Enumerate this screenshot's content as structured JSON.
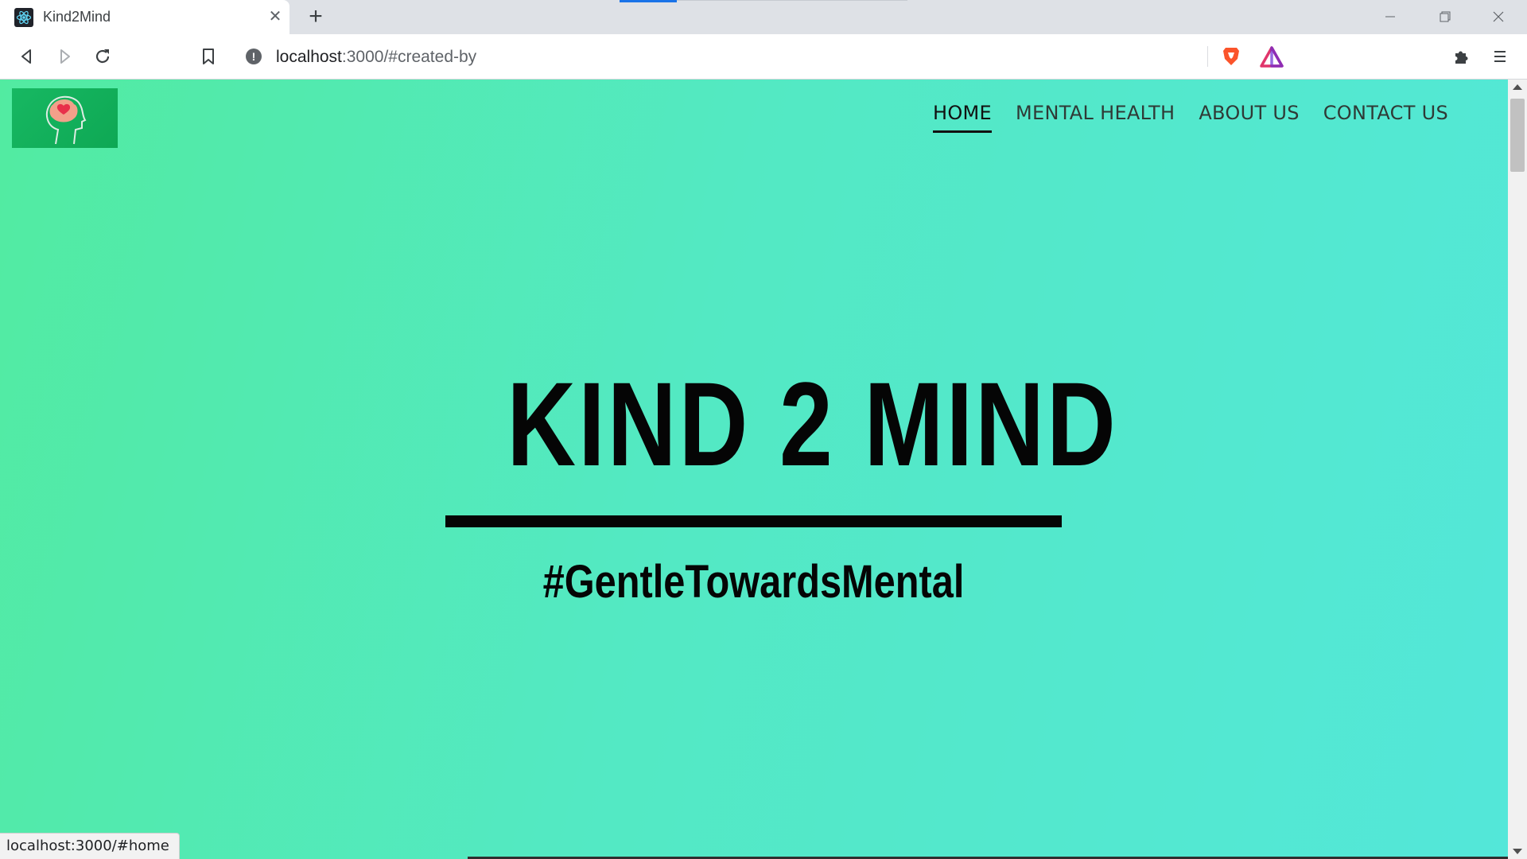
{
  "browser": {
    "tab": {
      "title": "Kind2Mind",
      "favicon": "react-icon"
    },
    "address": {
      "host": "localhost",
      "path": ":3000/#created-by"
    },
    "status_url": "localhost:3000/#home"
  },
  "site": {
    "nav": [
      {
        "label": "HOME",
        "active": true
      },
      {
        "label": "MENTAL HEALTH",
        "active": false
      },
      {
        "label": "ABOUT US",
        "active": false
      },
      {
        "label": "CONTACT US",
        "active": false
      }
    ],
    "hero": {
      "title": "KIND 2 MIND",
      "tagline": "#GentleTowardsMental"
    }
  },
  "colors": {
    "gradient_start": "#52eba1",
    "gradient_end": "#53e7d9",
    "text": "#050505",
    "logo_bg": "#17b862"
  }
}
